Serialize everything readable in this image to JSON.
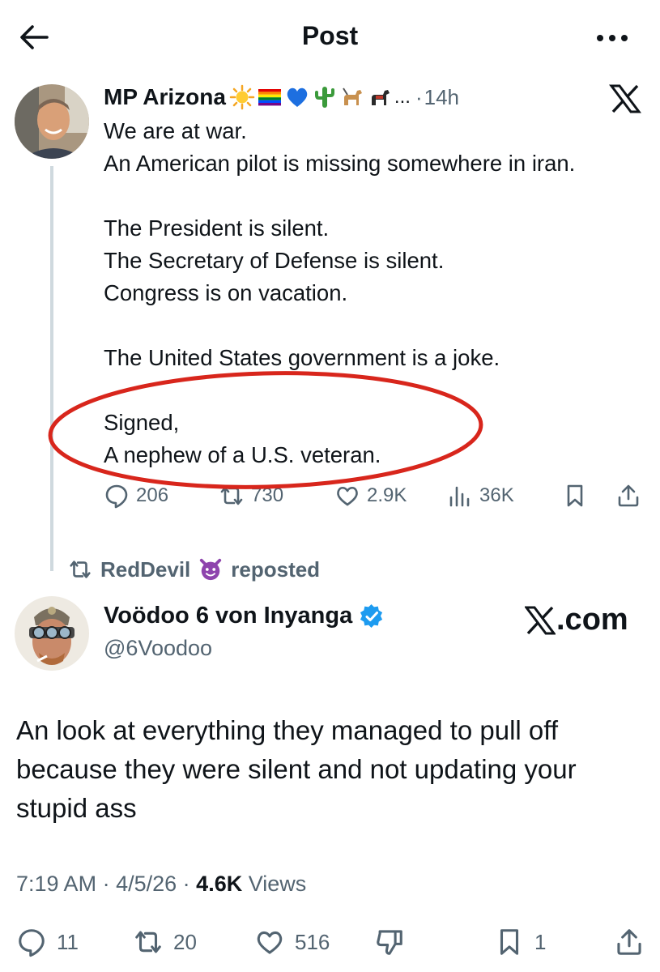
{
  "header": {
    "title": "Post",
    "back_icon": "arrow-left-icon",
    "more_icon": "more-horizontal-icon"
  },
  "quoted_post": {
    "author_name": "MP Arizona",
    "name_emojis": [
      "sun-emoji",
      "rainbow-flag-emoji",
      "blue-heart-emoji",
      "cactus-emoji",
      "guide-dog-emoji",
      "service-dog-emoji"
    ],
    "name_ellipsis": "...",
    "time": "14h",
    "text_lines": [
      "We are at war.",
      "An American pilot is missing somewhere in iran.",
      "",
      "The President is silent.",
      "The Secretary of Defense is silent.",
      "Congress is on vacation.",
      "",
      "The United States government is a joke.",
      "",
      "Signed,",
      "A nephew of a U.S. veteran."
    ],
    "annotation_color": "#d8261c",
    "stats": {
      "replies": "206",
      "reposts": "730",
      "likes": "2.9K",
      "views": "36K"
    }
  },
  "repost_banner": {
    "user": "RedDevil",
    "emoji": "smiling-devil-emoji",
    "label": "reposted"
  },
  "main_post": {
    "author_name": "Voödoo 6 von Inyanga",
    "verified": true,
    "handle": "@6Voodoo",
    "watermark": ".com",
    "text_lines": [
      "An look at everything they managed to pull off",
      "because they were silent and not updating your",
      "stupid ass"
    ],
    "time": "7:19 AM",
    "date": "4/5/26",
    "views_count": "4.6K",
    "views_label": "Views",
    "stats": {
      "replies": "11",
      "reposts": "20",
      "likes": "516",
      "bookmarks": "1"
    }
  },
  "colors": {
    "text": "#0f1419",
    "secondary": "#536471",
    "verified": "#1d9bf0",
    "thread_line": "#cfd9de"
  }
}
